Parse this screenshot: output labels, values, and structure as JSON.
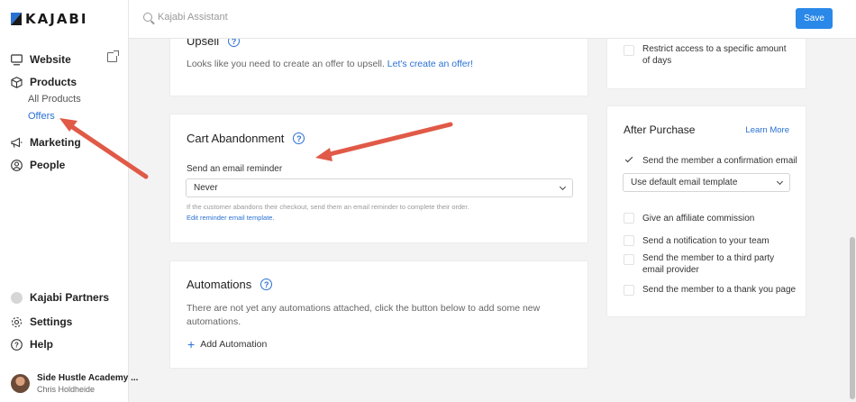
{
  "brand": {
    "name": "KAJABI",
    "accent": "#2a71d4",
    "button_color": "#2a88e8",
    "arrow_color": "#e05a47"
  },
  "sidebar": {
    "items": [
      {
        "label": "Website",
        "icon": "monitor-icon"
      },
      {
        "label": "Products",
        "icon": "box-icon"
      },
      {
        "label": "Marketing",
        "icon": "megaphone-icon"
      },
      {
        "label": "People",
        "icon": "person-circle-icon"
      }
    ],
    "sub_items": [
      {
        "label": "All Products",
        "active": false
      },
      {
        "label": "Offers",
        "active": true
      }
    ],
    "bottom": [
      {
        "label": "Kajabi Partners",
        "icon": "partners-icon"
      },
      {
        "label": "Settings",
        "icon": "gear-icon"
      },
      {
        "label": "Help",
        "icon": "help-icon"
      }
    ],
    "profile": {
      "name": "Side Hustle Academy ...",
      "user": "Chris Holdheide"
    }
  },
  "topbar": {
    "search_placeholder": "Kajabi Assistant",
    "save_label": "Save"
  },
  "upsell": {
    "title": "Upsell",
    "text": "Looks like you need to create an offer to upsell.",
    "link": "Let's create an offer!"
  },
  "cart": {
    "title": "Cart Abandonment",
    "field_label": "Send an email reminder",
    "selected": "Never",
    "help_text": "If the customer abandons their checkout, send them an email reminder to complete their order.",
    "help_link": "Edit reminder email template."
  },
  "automations": {
    "title": "Automations",
    "text": "There are not yet any automations attached, click the button below to add some new automations.",
    "add_label": "Add Automation"
  },
  "access": {
    "restrict_label": "Restrict access to a specific amount of days"
  },
  "after_purchase": {
    "title": "After Purchase",
    "learn_more": "Learn More",
    "confirmation_label": "Send the member a confirmation email",
    "template_selected": "Use default email template",
    "options": [
      {
        "label": "Give an affiliate commission",
        "checked": false
      },
      {
        "label": "Send a notification to your team",
        "checked": false
      },
      {
        "label": "Send the member to a third party email provider",
        "checked": false
      },
      {
        "label": "Send the member to a thank you page",
        "checked": false
      }
    ]
  }
}
